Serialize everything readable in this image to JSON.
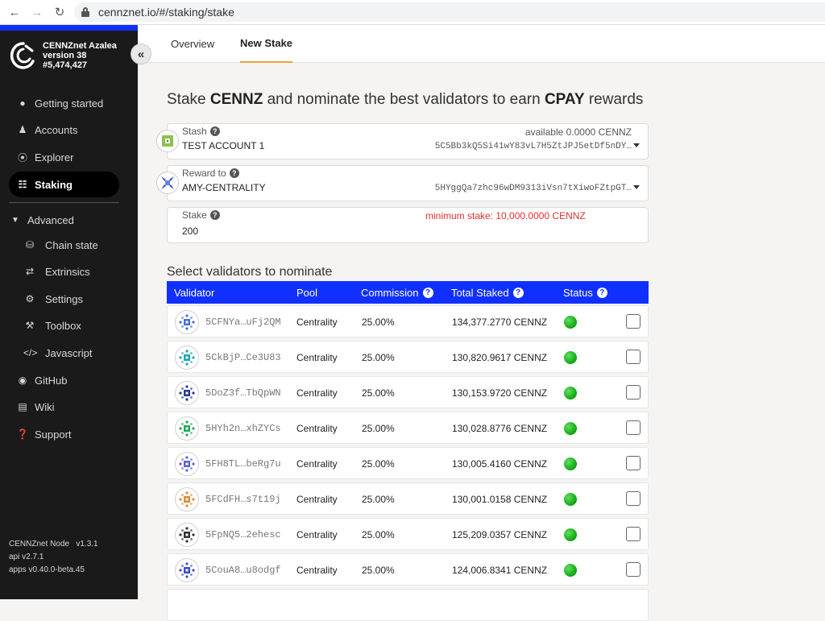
{
  "browser": {
    "url": "cennznet.io/#/staking/stake"
  },
  "sidebar": {
    "chain_name": "CENNZnet Azalea",
    "version": "version 38",
    "block": "#5,474,427",
    "items": [
      {
        "label": "Getting started",
        "icon": "rocket-icon"
      },
      {
        "label": "Accounts",
        "icon": "users-icon"
      },
      {
        "label": "Explorer",
        "icon": "compass-icon"
      },
      {
        "label": "Staking",
        "icon": "coins-icon",
        "active": true
      }
    ],
    "advanced_label": "Advanced",
    "advanced_items": [
      {
        "label": "Chain state",
        "icon": "database-icon"
      },
      {
        "label": "Extrinsics",
        "icon": "sync-icon"
      },
      {
        "label": "Settings",
        "icon": "gears-icon"
      },
      {
        "label": "Toolbox",
        "icon": "wrench-icon"
      },
      {
        "label": "Javascript",
        "icon": "code-icon"
      },
      {
        "label": "GitHub",
        "icon": "github-icon"
      },
      {
        "label": "Wiki",
        "icon": "book-icon"
      },
      {
        "label": "Support",
        "icon": "question-icon"
      }
    ],
    "footer": {
      "node": "CENNZnet Node",
      "node_version": "v1.3.1",
      "api": "api v2.7.1",
      "apps": "apps v0.40.0-beta.45"
    }
  },
  "tabs": [
    {
      "label": "Overview",
      "active": false
    },
    {
      "label": "New Stake",
      "active": true
    }
  ],
  "title": {
    "prefix": "Stake ",
    "token1": "CENNZ",
    "middle": " and nominate the best validators to earn ",
    "token2": "CPAY",
    "suffix": " rewards"
  },
  "stash": {
    "label": "Stash",
    "value": "TEST ACCOUNT 1",
    "available": "available 0.0000 CENNZ",
    "address": "5C5Bb3kQ5Si41wY83vL7H5ZtJPJ5etDf5nDY…"
  },
  "reward": {
    "label": "Reward to",
    "value": "AMY-CENTRALITY",
    "address": "5HYggQa7zhc96wDM9313iVsn7tXiwoFZtpGT…"
  },
  "stake": {
    "label": "Stake",
    "value": "200",
    "warning": "minimum stake: 10,000.0000 CENNZ",
    "warning_color": "#e03030"
  },
  "validators": {
    "section_title": "Select validators to nominate",
    "header_color": "#1130ff",
    "columns": [
      "Validator",
      "Pool",
      "Commission",
      "Total Staked",
      "Status"
    ],
    "rows": [
      {
        "address": "5CFNYa…uFj2QM",
        "pool": "Centrality",
        "commission": "25.00%",
        "staked": "134,377.2770 CENNZ",
        "accent": "#4a6fd8"
      },
      {
        "address": "5CkBjP…Ce3U83",
        "pool": "Centrality",
        "commission": "25.00%",
        "staked": "130,820.9617 CENNZ",
        "accent": "#1aa6b7"
      },
      {
        "address": "5DoZ3f…TbQpWN",
        "pool": "Centrality",
        "commission": "25.00%",
        "staked": "130,153.9720 CENNZ",
        "accent": "#2a3a8a"
      },
      {
        "address": "5HYh2n…xhZYCs",
        "pool": "Centrality",
        "commission": "25.00%",
        "staked": "130,028.8776 CENNZ",
        "accent": "#22aa55"
      },
      {
        "address": "5FH8TL…beRg7u",
        "pool": "Centrality",
        "commission": "25.00%",
        "staked": "130,005.4160 CENNZ",
        "accent": "#5a63d8"
      },
      {
        "address": "5FCdFH…s7t19j",
        "pool": "Centrality",
        "commission": "25.00%",
        "staked": "130,001.0158 CENNZ",
        "accent": "#e08a3a"
      },
      {
        "address": "5FpNQ5…2ehesc",
        "pool": "Centrality",
        "commission": "25.00%",
        "staked": "125,209.0357 CENNZ",
        "accent": "#333333"
      },
      {
        "address": "5CouA8…u8odgf",
        "pool": "Centrality",
        "commission": "25.00%",
        "staked": "124,006.8341 CENNZ",
        "accent": "#3a4ed0"
      }
    ]
  }
}
